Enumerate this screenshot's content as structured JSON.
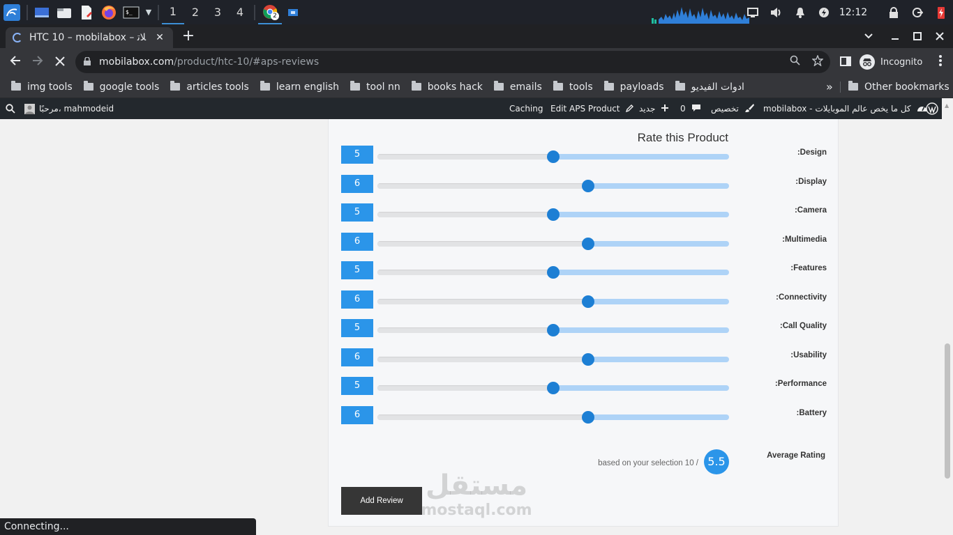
{
  "taskbar": {
    "workspaces": [
      "1",
      "2",
      "3",
      "4"
    ],
    "chrome_badge": "2",
    "clock": "12:12"
  },
  "tab": {
    "title": "HTC 10 – mobilabox – ﻼﺗ",
    "close": "✕",
    "new_tab": "+"
  },
  "toolbar": {
    "url_host": "mobilabox.com",
    "url_path": "/product/htc-10/#aps-reviews",
    "incognito_label": "Incognito"
  },
  "bookmarks": {
    "items": [
      "img tools",
      "google tools",
      "articles tools",
      "learn english",
      "tool nn",
      "books hack",
      "emails",
      "tools",
      "payloads",
      "ادوات الفيديو"
    ],
    "more": "»",
    "other": "Other bookmarks"
  },
  "wpbar": {
    "greeting": "مرحبًا، mahmodeid",
    "caching": "Caching",
    "edit_product": "Edit APS Product",
    "new_label": "جديد",
    "comments_count": "0",
    "customize": "تخصيص",
    "site_name": "mobilabox - كل ما يخص عالم الموبايلات"
  },
  "rating": {
    "title": "Rate this Product",
    "min": 0,
    "max": 10,
    "rows": [
      {
        "label": "Design:",
        "value": 5
      },
      {
        "label": "Display:",
        "value": 6
      },
      {
        "label": "Camera:",
        "value": 5
      },
      {
        "label": "Multimedia:",
        "value": 6
      },
      {
        "label": "Features:",
        "value": 5
      },
      {
        "label": "Connectivity:",
        "value": 6
      },
      {
        "label": "Call Quality:",
        "value": 5
      },
      {
        "label": "Usability:",
        "value": 6
      },
      {
        "label": "Performance:",
        "value": 5
      },
      {
        "label": "Battery:",
        "value": 6
      }
    ],
    "average_label": "Average Rating",
    "average_value": "5.5",
    "average_text": "based on your selection 10 /",
    "add_review": "Add Review"
  },
  "watermark": {
    "arabic": "مستقل",
    "latin": "mostaql.com"
  },
  "status": "Connecting..."
}
